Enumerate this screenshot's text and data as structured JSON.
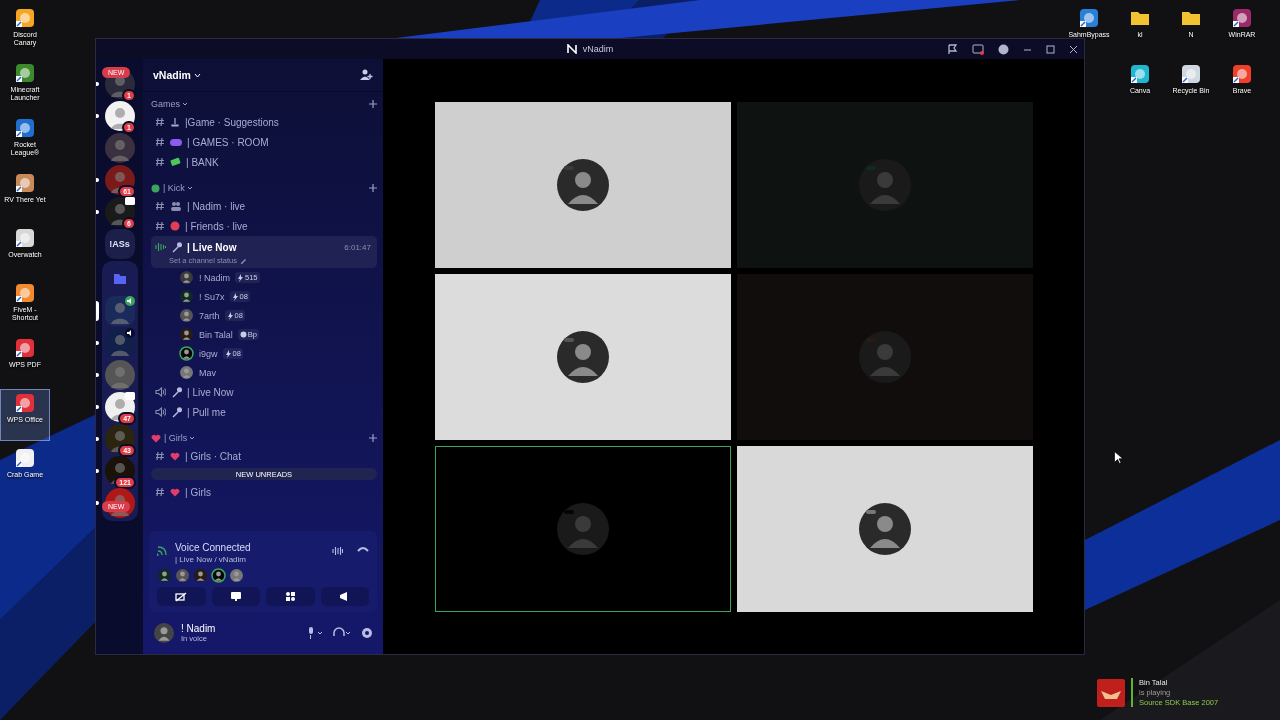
{
  "desktop": {
    "left_icons": [
      {
        "label": "Discord Canary",
        "color": "#f5a623",
        "selected": false
      },
      {
        "label": "Minecraft Launcher",
        "color": "#3c8a2e",
        "selected": false
      },
      {
        "label": "Rocket League®",
        "color": "#1f6fd1",
        "selected": false
      },
      {
        "label": "RV There Yet",
        "color": "#c98a5a",
        "selected": false
      },
      {
        "label": "Overwatch",
        "color": "#d8d8d8",
        "selected": false
      },
      {
        "label": "FiveM - Shortcut",
        "color": "#f28a30",
        "selected": false
      },
      {
        "label": "WPS PDF",
        "color": "#e0303a",
        "selected": false
      },
      {
        "label": "WPS Office",
        "color": "#e0303a",
        "selected": true
      },
      {
        "label": "Crab Game",
        "color": "#f0f0f0",
        "selected": false
      }
    ],
    "right_icons": [
      {
        "label": "SahmBypass",
        "kind": "app",
        "color": "#2a7fd8"
      },
      {
        "label": "kl",
        "kind": "folder",
        "color": "#f2c230"
      },
      {
        "label": "N",
        "kind": "folder",
        "color": "#f2c230"
      },
      {
        "label": "WinRAR",
        "kind": "app",
        "color": "#9b2a6a"
      },
      {
        "label": "Canva",
        "kind": "app",
        "color": "#20b8d0"
      },
      {
        "label": "Recycle Bin",
        "kind": "app",
        "color": "#cfd8e0"
      },
      {
        "label": "Brave",
        "kind": "app",
        "color": "#f0402a"
      }
    ]
  },
  "window": {
    "title": "vNadim"
  },
  "rail": {
    "new_labels": [
      "NEW",
      "NEW"
    ],
    "servers": [
      {
        "kind": "server",
        "color": "#2a2a3a",
        "badge": "1",
        "unread": true,
        "selected": false,
        "in_voice": false,
        "streaming": false
      },
      {
        "kind": "server",
        "color": "#f2f2f2",
        "badge": "1",
        "unread": true,
        "selected": false,
        "in_voice": false,
        "streaming": false
      },
      {
        "kind": "server",
        "color": "#3a3040",
        "unread": false,
        "selected": false,
        "in_voice": false,
        "streaming": false
      },
      {
        "kind": "server",
        "color": "#7a1a1a",
        "badge": "61",
        "unread": true,
        "selected": false,
        "in_voice": false,
        "streaming": false
      },
      {
        "kind": "server",
        "color": "#1a1a1a",
        "badge": "6",
        "unread": true,
        "selected": false,
        "in_voice": false,
        "streaming": true
      },
      {
        "kind": "text",
        "label": "!ASs",
        "unread": false,
        "selected": false
      },
      {
        "kind": "folder",
        "color": "#5865f2",
        "children": [
          {
            "kind": "server",
            "color": "#1a2a5a",
            "unread": false,
            "selected": true,
            "in_voice": true,
            "streaming": false
          },
          {
            "kind": "server",
            "color": "#10204a",
            "unread": true,
            "selected": false,
            "in_voice": true,
            "streaming": false
          },
          {
            "kind": "server",
            "color": "#555555",
            "unread": true,
            "selected": false,
            "in_voice": false,
            "streaming": false
          },
          {
            "kind": "server",
            "color": "#f0f0f0",
            "badge": "47",
            "unread": true,
            "selected": false,
            "in_voice": false,
            "streaming": true
          },
          {
            "kind": "server",
            "color": "#2a2410",
            "badge": "43",
            "unread": true,
            "selected": false,
            "in_voice": false,
            "streaming": false
          },
          {
            "kind": "server",
            "color": "#1a1208",
            "badge": "121",
            "unread": true,
            "selected": false,
            "in_voice": false,
            "streaming": false
          },
          {
            "kind": "server",
            "color": "#b01818",
            "unread": true,
            "selected": false,
            "in_voice": false,
            "streaming": false
          }
        ]
      }
    ]
  },
  "sidebar": {
    "server_name": "vNadim",
    "categories": [
      {
        "name": "Games",
        "channels": [
          {
            "kind": "text",
            "name": "|Game · Suggestions",
            "selected": false
          },
          {
            "kind": "text",
            "name": "| GAMES · ROOM",
            "selected": false
          },
          {
            "kind": "text",
            "name": "| BANK",
            "selected": false
          }
        ]
      },
      {
        "name": "| Kick",
        "channels": [
          {
            "kind": "text",
            "name": "| Nadim · live",
            "selected": false
          },
          {
            "kind": "text",
            "name": "| Friends · live",
            "selected": false
          },
          {
            "kind": "voice",
            "name": "| Live Now",
            "selected": true,
            "timer": "6:01:47",
            "status": "Set a channel status",
            "members": [
              {
                "name": "! Nadim",
                "badge": "515",
                "kind": "bolt",
                "speaking": false
              },
              {
                "name": "! Su7x",
                "badge": "08",
                "kind": "bolt",
                "speaking": false
              },
              {
                "name": "7arth",
                "badge": "08",
                "kind": "bolt",
                "speaking": false
              },
              {
                "name": "Bin Talal",
                "badge": "Bp",
                "kind": "skull",
                "speaking": false
              },
              {
                "name": "i9gw",
                "badge": "08",
                "kind": "bolt",
                "speaking": true
              },
              {
                "name": "Mav",
                "kind": "plain",
                "speaking": false
              }
            ]
          },
          {
            "kind": "voice",
            "name": "| Live Now",
            "selected": false
          },
          {
            "kind": "voice",
            "name": "| Pull me",
            "selected": false
          }
        ]
      },
      {
        "name": "| Girls",
        "channels": [
          {
            "kind": "text",
            "name": "| Girls · Chat",
            "selected": false
          },
          {
            "kind": "text",
            "name": "| Girls",
            "selected": false
          }
        ]
      }
    ],
    "new_unreads": "NEW UNREADS"
  },
  "voice_panel": {
    "title": "Voice Connected",
    "channel": "| Live Now / vNadim",
    "participants": [
      {
        "speaking": false
      },
      {
        "speaking": false
      },
      {
        "speaking": false
      },
      {
        "speaking": true
      },
      {
        "speaking": false
      }
    ]
  },
  "user": {
    "name": "! Nadim",
    "status": "In voice"
  },
  "tiles": [
    {
      "color": "#cfcfcf",
      "speaking": false
    },
    {
      "color": "#0e1311",
      "speaking": false
    },
    {
      "color": "#dcdcdc",
      "speaking": false
    },
    {
      "color": "#120d0d",
      "speaking": false
    },
    {
      "color": "#000000",
      "speaking": true
    },
    {
      "color": "#d9d9d9",
      "speaking": false
    }
  ],
  "notification": {
    "title": "Bin Talal",
    "line": "is playing",
    "game": "Source SDK Base 2007"
  }
}
